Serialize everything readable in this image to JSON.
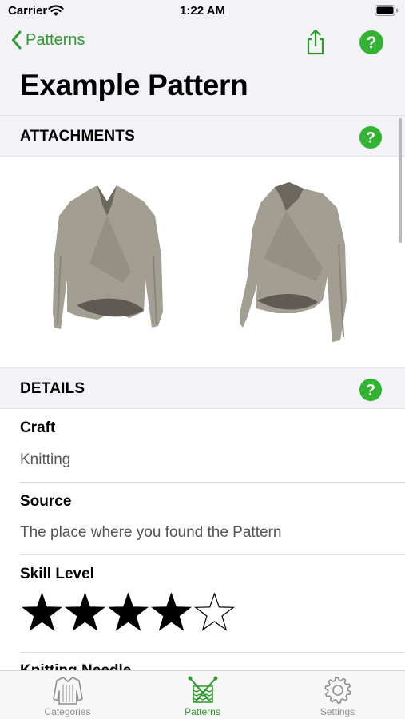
{
  "status_bar": {
    "carrier": "Carrier",
    "time": "1:22 AM"
  },
  "nav": {
    "back_label": "Patterns",
    "title": "Example Pattern"
  },
  "sections": {
    "attachments": "ATTACHMENTS",
    "details": "DETAILS"
  },
  "details": {
    "craft": {
      "title": "Craft",
      "value": "Knitting"
    },
    "source": {
      "title": "Source",
      "value": "The place where you found the Pattern"
    },
    "skill": {
      "title": "Skill Level",
      "rating": 4,
      "max": 5
    },
    "next_title": "Knitting Needle"
  },
  "tabs": [
    {
      "label": "Categories",
      "active": false
    },
    {
      "label": "Patterns",
      "active": true
    },
    {
      "label": "Settings",
      "active": false
    }
  ],
  "colors": {
    "accent": "#2e9b2e",
    "help": "#32b332",
    "sweater": "#a39e92",
    "group_bg": "#f2f2f7"
  },
  "icons": [
    "wifi-icon",
    "battery-icon",
    "chevron-left-icon",
    "share-icon",
    "help-icon",
    "star-icon",
    "sweater-icon",
    "knitting-icon",
    "gear-icon"
  ]
}
